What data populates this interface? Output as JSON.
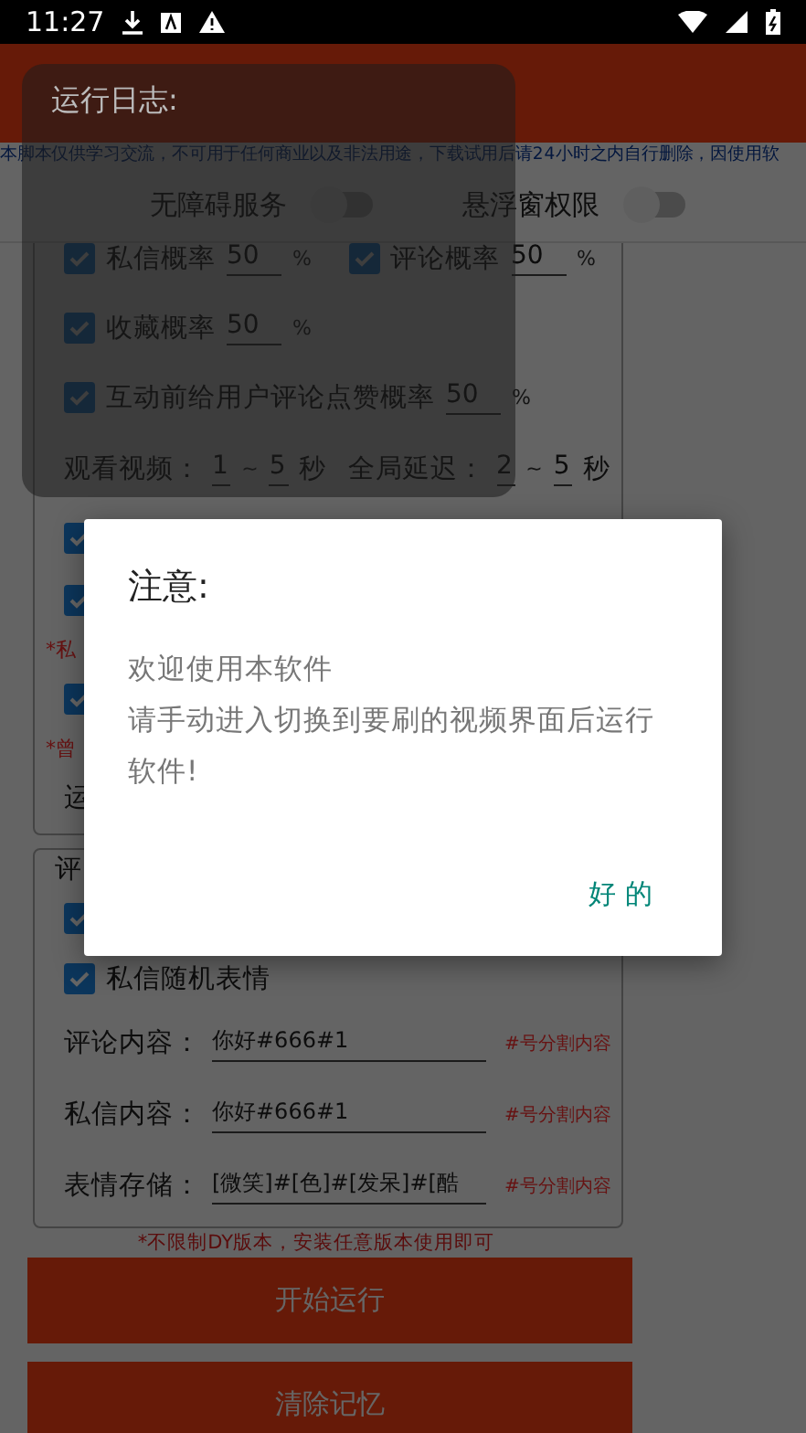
{
  "status_bar": {
    "time": "11:27"
  },
  "notice": "本脚本仅供学习交流，不可用于任何商业以及非法用途，下载试用后请24小时之内自行删除，因使用软",
  "permissions": [
    {
      "label": "无障碍服务",
      "on": false
    },
    {
      "label": "悬浮窗权限",
      "on": false
    }
  ],
  "settings": {
    "items": [
      {
        "kind": "check_pair",
        "items": [
          {
            "label": "私信概率",
            "value": "50",
            "unit": "%",
            "checked": true
          },
          {
            "label": "评论概率",
            "value": "50",
            "unit": "%",
            "checked": true
          }
        ]
      },
      {
        "kind": "check_percent",
        "label": "收藏概率",
        "value": "50",
        "unit": "%",
        "checked": true
      },
      {
        "kind": "check_percent",
        "label": "互动前给用户评论点赞概率",
        "value": "50",
        "unit": "%",
        "checked": true
      },
      {
        "kind": "ranges",
        "items": [
          {
            "label": "观看视频：",
            "min": "1",
            "sep": "~",
            "max": "5",
            "unit": "秒"
          },
          {
            "label": "全局延迟：",
            "min": "2",
            "sep": "~",
            "max": "5",
            "unit": "秒"
          }
        ]
      },
      {
        "kind": "check",
        "checked": true
      },
      {
        "kind": "check",
        "checked": true
      },
      {
        "kind": "note",
        "text": "*私"
      },
      {
        "kind": "check",
        "checked": true
      },
      {
        "kind": "note",
        "text": "*曾"
      },
      {
        "kind": "text",
        "text": "运"
      }
    ]
  },
  "comment_card": {
    "title": "评",
    "items": [
      {
        "kind": "check",
        "checked": true
      },
      {
        "kind": "check",
        "label": "私信随机表情",
        "checked": true
      },
      {
        "kind": "input",
        "label": "评论内容：",
        "value": "你好#666#1",
        "hint": "#号分割内容"
      },
      {
        "kind": "input",
        "label": "私信内容：",
        "value": "你好#666#1",
        "hint": "#号分割内容"
      },
      {
        "kind": "input",
        "label": "表情存储：",
        "value": "[微笑]#[色]#[发呆]#[酷",
        "hint": "#号分割内容"
      }
    ]
  },
  "footer_note": "*不限制DY版本，安装任意版本使用即可",
  "buttons": [
    "开始运行",
    "清除记忆"
  ],
  "log_panel": {
    "title": "运行日志:"
  },
  "dialog": {
    "title": "注意:",
    "lines": [
      "欢迎使用本软件",
      "请手动进入切换到要刷的视频界面后运行软件!"
    ],
    "button": "好 的"
  }
}
